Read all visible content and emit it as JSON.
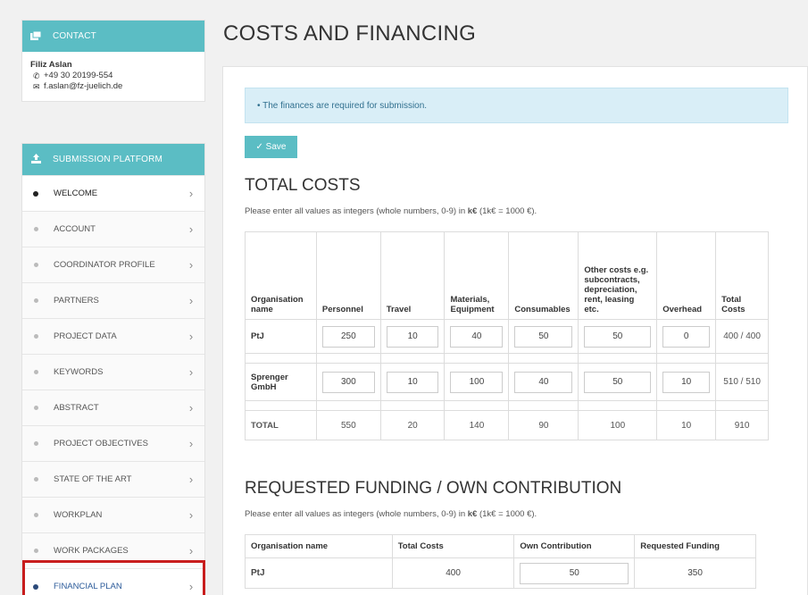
{
  "contact": {
    "header": "CONTACT",
    "name": "Filiz Aslan",
    "phone": "+49 30 20199-554",
    "email": "f.aslan@fz-juelich.de"
  },
  "nav": {
    "header": "SUBMISSION PLATFORM",
    "items": [
      {
        "label": "WELCOME"
      },
      {
        "label": "ACCOUNT"
      },
      {
        "label": "COORDINATOR PROFILE"
      },
      {
        "label": "PARTNERS"
      },
      {
        "label": "PROJECT DATA"
      },
      {
        "label": "KEYWORDS"
      },
      {
        "label": "ABSTRACT"
      },
      {
        "label": "PROJECT OBJECTIVES"
      },
      {
        "label": "STATE OF THE ART"
      },
      {
        "label": "WORKPLAN"
      },
      {
        "label": "WORK PACKAGES"
      },
      {
        "label": "FINANCIAL PLAN"
      }
    ]
  },
  "page": {
    "title": "COSTS AND FINANCING",
    "alert": "• The finances are required for submission.",
    "save_label": "✓ Save"
  },
  "total_costs": {
    "title": "TOTAL COSTS",
    "hint_pre": "Please enter all values as integers (whole numbers, 0-9) in ",
    "hint_unit": "k€",
    "hint_post": " (1k€ = 1000 €).",
    "headers": {
      "org": "Organisation name",
      "personnel": "Personnel",
      "travel": "Travel",
      "materials": "Materials, Equipment",
      "consumables": "Consumables",
      "other": "Other costs e.g. subcontracts, depreciation, rent, leasing etc.",
      "overhead": "Overhead",
      "total": "Total Costs"
    },
    "rows": [
      {
        "org": "PtJ",
        "personnel": "250",
        "travel": "10",
        "materials": "40",
        "consumables": "50",
        "other": "50",
        "overhead": "0",
        "total": "400 / 400"
      },
      {
        "org": "Sprenger GmbH",
        "personnel": "300",
        "travel": "10",
        "materials": "100",
        "consumables": "40",
        "other": "50",
        "overhead": "10",
        "total": "510 / 510"
      }
    ],
    "sum": {
      "org": "TOTAL",
      "personnel": "550",
      "travel": "20",
      "materials": "140",
      "consumables": "90",
      "other": "100",
      "overhead": "10",
      "total": "910"
    }
  },
  "funding": {
    "title": "REQUESTED FUNDING / OWN CONTRIBUTION",
    "hint_pre": "Please enter all values as integers (whole numbers, 0-9) in ",
    "hint_unit": "k€",
    "hint_post": " (1k€ = 1000 €).",
    "headers": {
      "org": "Organisation name",
      "total": "Total Costs",
      "own": "Own Contribution",
      "requested": "Requested Funding"
    },
    "rows": [
      {
        "org": "PtJ",
        "total": "400",
        "own": "50",
        "requested": "350"
      }
    ]
  },
  "colors": {
    "accent": "#5bbdc4",
    "alert_bg": "#d9eef7",
    "highlight": "#c81d1d"
  }
}
